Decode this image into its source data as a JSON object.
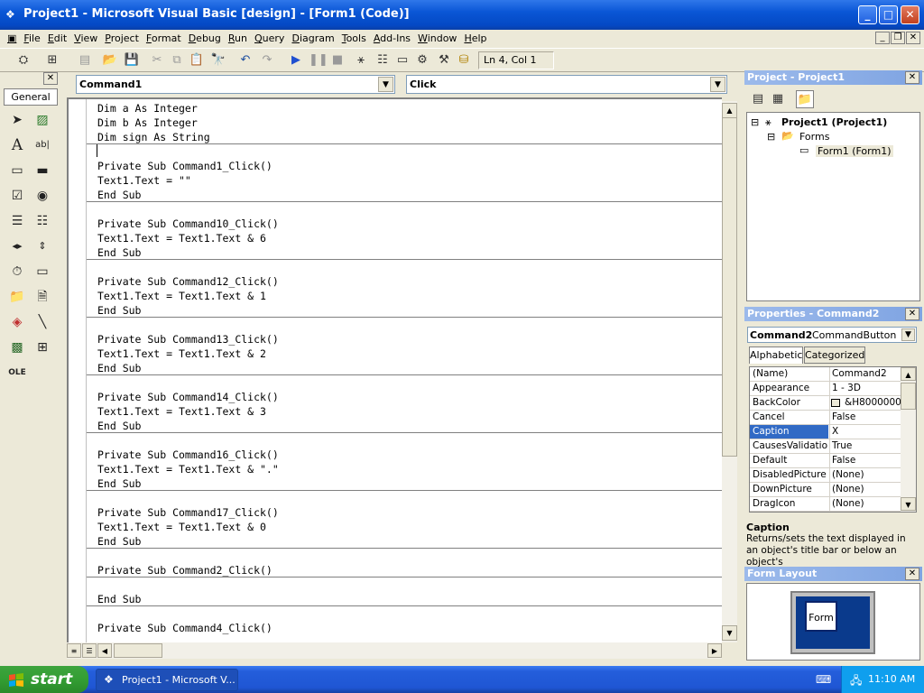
{
  "window": {
    "title": "Project1 - Microsoft Visual Basic [design] - [Form1 (Code)]"
  },
  "menu": [
    "File",
    "Edit",
    "View",
    "Project",
    "Format",
    "Debug",
    "Run",
    "Query",
    "Diagram",
    "Tools",
    "Add-Ins",
    "Window",
    "Help"
  ],
  "toolbar": {
    "position": "Ln 4, Col 1"
  },
  "toolbox": {
    "tab": "General"
  },
  "code": {
    "object_combo": "Command1",
    "procedure_combo": "Click",
    "lines": [
      "Dim a As Integer",
      "Dim b As Integer",
      "Dim sign As String",
      "",
      "Private Sub Command1_Click()",
      "Text1.Text = \"\"",
      "End Sub",
      "",
      "Private Sub Command10_Click()",
      "Text1.Text = Text1.Text & 6",
      "End Sub",
      "",
      "Private Sub Command12_Click()",
      "Text1.Text = Text1.Text & 1",
      "End Sub",
      "",
      "Private Sub Command13_Click()",
      "Text1.Text = Text1.Text & 2",
      "End Sub",
      "",
      "Private Sub Command14_Click()",
      "Text1.Text = Text1.Text & 3",
      "End Sub",
      "",
      "Private Sub Command16_Click()",
      "Text1.Text = Text1.Text & \".\"",
      "End Sub",
      "",
      "Private Sub Command17_Click()",
      "Text1.Text = Text1.Text & 0",
      "End Sub",
      "",
      "Private Sub Command2_Click()",
      "",
      "End Sub",
      "",
      "Private Sub Command4_Click()"
    ]
  },
  "project": {
    "title": "Project - Project1",
    "root": "Project1 (Project1)",
    "folder": "Forms",
    "form": "Form1 (Form1)"
  },
  "properties": {
    "title": "Properties - Command2",
    "object_name": "Command2",
    "object_type": "CommandButton",
    "tabs": [
      "Alphabetic",
      "Categorized"
    ],
    "rows": [
      {
        "name": "(Name)",
        "value": "Command2"
      },
      {
        "name": "Appearance",
        "value": "1 - 3D"
      },
      {
        "name": "BackColor",
        "value": "&H8000000F"
      },
      {
        "name": "Cancel",
        "value": "False"
      },
      {
        "name": "Caption",
        "value": "X"
      },
      {
        "name": "CausesValidation",
        "value": "True"
      },
      {
        "name": "Default",
        "value": "False"
      },
      {
        "name": "DisabledPicture",
        "value": "(None)"
      },
      {
        "name": "DownPicture",
        "value": "(None)"
      },
      {
        "name": "DragIcon",
        "value": "(None)"
      }
    ],
    "desc_title": "Caption",
    "desc_text": "Returns/sets the text displayed in an object's title bar or below an object's"
  },
  "layout": {
    "title": "Form Layout",
    "form_label": "Form"
  },
  "taskbar": {
    "start": "start",
    "task": "Project1 - Microsoft V...",
    "clock": "11:10 AM"
  }
}
